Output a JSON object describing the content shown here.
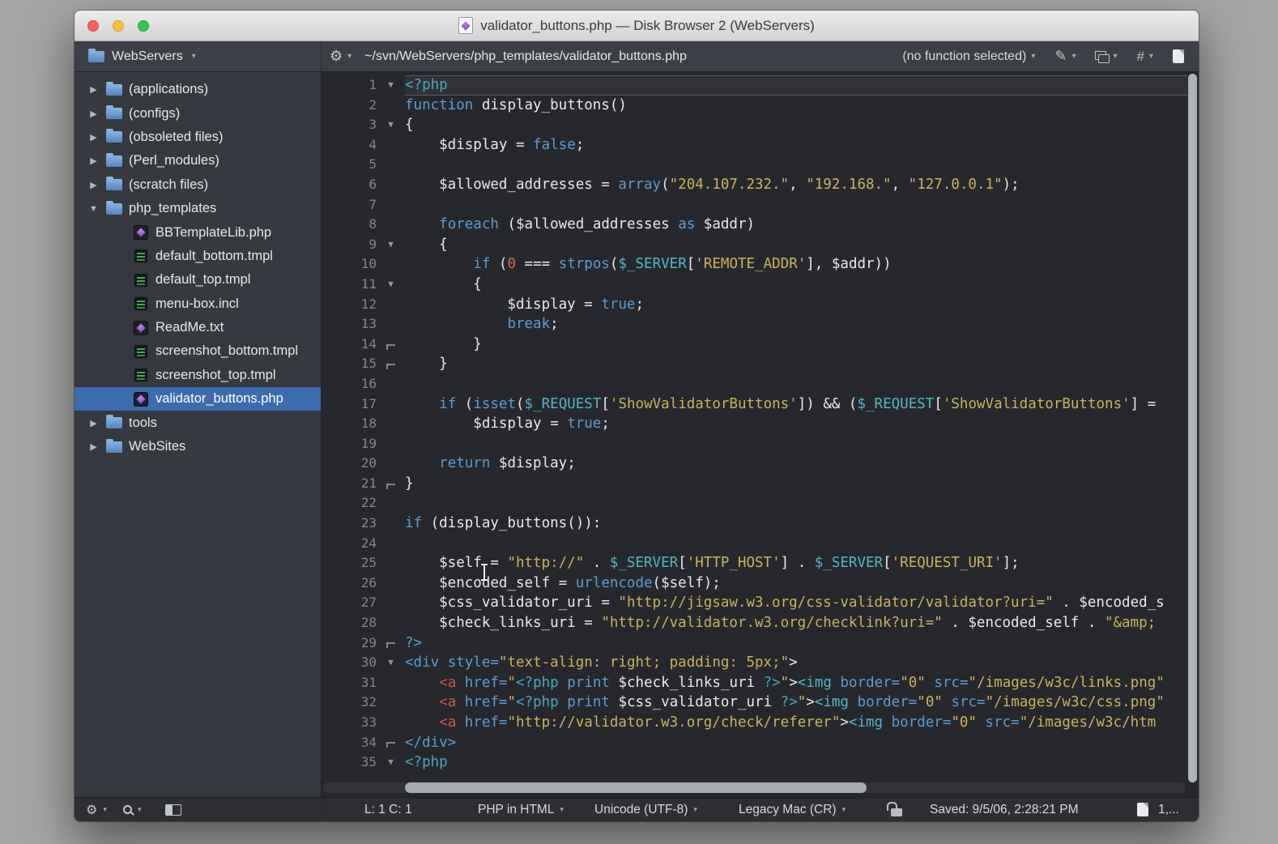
{
  "window": {
    "title": "validator_buttons.php — Disk Browser 2 (WebServers)"
  },
  "toolbar": {
    "sidebar_title": "WebServers",
    "path": "~/svn/WebServers/php_templates/validator_buttons.php",
    "function_selector": "(no function selected)"
  },
  "sidebar": {
    "items": [
      {
        "label": "(applications)",
        "kind": "folder",
        "arrow": "right",
        "depth": 0
      },
      {
        "label": "(configs)",
        "kind": "folder",
        "arrow": "right",
        "depth": 0
      },
      {
        "label": "(obsoleted files)",
        "kind": "folder",
        "arrow": "right",
        "depth": 0
      },
      {
        "label": "(Perl_modules)",
        "kind": "folder",
        "arrow": "right",
        "depth": 0
      },
      {
        "label": "(scratch files)",
        "kind": "folder",
        "arrow": "right",
        "depth": 0
      },
      {
        "label": "php_templates",
        "kind": "folder",
        "arrow": "down",
        "depth": 0
      },
      {
        "label": "BBTemplateLib.php",
        "kind": "doc",
        "depth": 1
      },
      {
        "label": "default_bottom.tmpl",
        "kind": "tmpl",
        "depth": 1
      },
      {
        "label": "default_top.tmpl",
        "kind": "tmpl",
        "depth": 1
      },
      {
        "label": "menu-box.incl",
        "kind": "tmpl",
        "depth": 1
      },
      {
        "label": "ReadMe.txt",
        "kind": "doc",
        "depth": 1
      },
      {
        "label": "screenshot_bottom.tmpl",
        "kind": "tmpl",
        "depth": 1
      },
      {
        "label": "screenshot_top.tmpl",
        "kind": "tmpl",
        "depth": 1
      },
      {
        "label": "validator_buttons.php",
        "kind": "doc",
        "depth": 1,
        "selected": true
      },
      {
        "label": "tools",
        "kind": "folder",
        "arrow": "right",
        "depth": 0
      },
      {
        "label": "WebSites",
        "kind": "folder",
        "arrow": "right",
        "depth": 0
      }
    ]
  },
  "editor": {
    "lines": [
      {
        "n": 1,
        "fold": "open",
        "cur": true,
        "segs": [
          [
            "<?php",
            "p"
          ]
        ]
      },
      {
        "n": 2,
        "segs": [
          [
            "function",
            "k"
          ],
          [
            " display_buttons()",
            "d"
          ]
        ]
      },
      {
        "n": 3,
        "fold": "open",
        "segs": [
          [
            "{",
            "d"
          ]
        ]
      },
      {
        "n": 4,
        "segs": [
          [
            "    $display = ",
            "d"
          ],
          [
            "false",
            "k"
          ],
          [
            ";",
            "d"
          ]
        ]
      },
      {
        "n": 5,
        "segs": []
      },
      {
        "n": 6,
        "segs": [
          [
            "    $allowed_addresses = ",
            "d"
          ],
          [
            "array",
            "k"
          ],
          [
            "(",
            "d"
          ],
          [
            "\"204.107.232.\"",
            "s"
          ],
          [
            ", ",
            "d"
          ],
          [
            "\"192.168.\"",
            "s"
          ],
          [
            ", ",
            "d"
          ],
          [
            "\"127.0.0.1\"",
            "s"
          ],
          [
            ");",
            "d"
          ]
        ]
      },
      {
        "n": 7,
        "segs": []
      },
      {
        "n": 8,
        "segs": [
          [
            "    ",
            "d"
          ],
          [
            "foreach",
            "k"
          ],
          [
            " ($allowed_addresses ",
            "d"
          ],
          [
            "as",
            "k"
          ],
          [
            " $addr)",
            "d"
          ]
        ]
      },
      {
        "n": 9,
        "fold": "open",
        "segs": [
          [
            "    {",
            "d"
          ]
        ]
      },
      {
        "n": 10,
        "segs": [
          [
            "        ",
            "d"
          ],
          [
            "if",
            "k"
          ],
          [
            " (",
            "d"
          ],
          [
            "0",
            "n"
          ],
          [
            " === ",
            "d"
          ],
          [
            "strpos",
            "k"
          ],
          [
            "(",
            "d"
          ],
          [
            "$_SERVER",
            "g"
          ],
          [
            "[",
            "d"
          ],
          [
            "'REMOTE_ADDR'",
            "s"
          ],
          [
            "], $addr))",
            "d"
          ]
        ]
      },
      {
        "n": 11,
        "fold": "open",
        "segs": [
          [
            "        {",
            "d"
          ]
        ]
      },
      {
        "n": 12,
        "segs": [
          [
            "            $display = ",
            "d"
          ],
          [
            "true",
            "k"
          ],
          [
            ";",
            "d"
          ]
        ]
      },
      {
        "n": 13,
        "segs": [
          [
            "            ",
            "d"
          ],
          [
            "break",
            "k"
          ],
          [
            ";",
            "d"
          ]
        ]
      },
      {
        "n": 14,
        "fold": "end",
        "segs": [
          [
            "        }",
            "d"
          ]
        ]
      },
      {
        "n": 15,
        "fold": "end",
        "segs": [
          [
            "    }",
            "d"
          ]
        ]
      },
      {
        "n": 16,
        "segs": []
      },
      {
        "n": 17,
        "segs": [
          [
            "    ",
            "d"
          ],
          [
            "if",
            "k"
          ],
          [
            " (",
            "d"
          ],
          [
            "isset",
            "k"
          ],
          [
            "(",
            "d"
          ],
          [
            "$_REQUEST",
            "g"
          ],
          [
            "[",
            "d"
          ],
          [
            "'ShowValidatorButtons'",
            "s"
          ],
          [
            "]) && (",
            "d"
          ],
          [
            "$_REQUEST",
            "g"
          ],
          [
            "[",
            "d"
          ],
          [
            "'ShowValidatorButtons'",
            "s"
          ],
          [
            "] =",
            "d"
          ]
        ]
      },
      {
        "n": 18,
        "segs": [
          [
            "        $display = ",
            "d"
          ],
          [
            "true",
            "k"
          ],
          [
            ";",
            "d"
          ]
        ]
      },
      {
        "n": 19,
        "segs": []
      },
      {
        "n": 20,
        "segs": [
          [
            "    ",
            "d"
          ],
          [
            "return",
            "k"
          ],
          [
            " $display;",
            "d"
          ]
        ]
      },
      {
        "n": 21,
        "fold": "end",
        "segs": [
          [
            "}",
            "d"
          ]
        ]
      },
      {
        "n": 22,
        "segs": []
      },
      {
        "n": 23,
        "segs": [
          [
            "if",
            "k"
          ],
          [
            " (display_buttons()):",
            "d"
          ]
        ]
      },
      {
        "n": 24,
        "segs": []
      },
      {
        "n": 25,
        "segs": [
          [
            "    $self = ",
            "d"
          ],
          [
            "\"http://\"",
            "s"
          ],
          [
            " . ",
            "d"
          ],
          [
            "$_SERVER",
            "g"
          ],
          [
            "[",
            "d"
          ],
          [
            "'HTTP_HOST'",
            "s"
          ],
          [
            "] . ",
            "d"
          ],
          [
            "$_SERVER",
            "g"
          ],
          [
            "[",
            "d"
          ],
          [
            "'REQUEST_URI'",
            "s"
          ],
          [
            "];",
            "d"
          ]
        ]
      },
      {
        "n": 26,
        "segs": [
          [
            "    $encoded_self = ",
            "d"
          ],
          [
            "urlencode",
            "k"
          ],
          [
            "($self);",
            "d"
          ]
        ]
      },
      {
        "n": 27,
        "segs": [
          [
            "    $css_validator_uri = ",
            "d"
          ],
          [
            "\"http://jigsaw.w3.org/css-validator/validator?uri=\"",
            "s"
          ],
          [
            " . $encoded_s",
            "d"
          ]
        ]
      },
      {
        "n": 28,
        "segs": [
          [
            "    $check_links_uri = ",
            "d"
          ],
          [
            "\"http://validator.w3.org/checklink?uri=\"",
            "s"
          ],
          [
            " . $encoded_self . ",
            "d"
          ],
          [
            "\"&amp;",
            "s"
          ]
        ]
      },
      {
        "n": 29,
        "fold": "end",
        "segs": [
          [
            "?>",
            "p"
          ]
        ]
      },
      {
        "n": 30,
        "fold": "open",
        "segs": [
          [
            "<div",
            "k"
          ],
          [
            " ",
            "d"
          ],
          [
            "style=",
            "k"
          ],
          [
            "\"text-align: right; padding: 5px;\"",
            "s"
          ],
          [
            ">",
            "d"
          ]
        ]
      },
      {
        "n": 31,
        "segs": [
          [
            "    ",
            "d"
          ],
          [
            "<a",
            "r"
          ],
          [
            " ",
            "d"
          ],
          [
            "href=",
            "k"
          ],
          [
            "\"",
            "s"
          ],
          [
            "<?php",
            "p"
          ],
          [
            " ",
            "d"
          ],
          [
            "print",
            "k"
          ],
          [
            " $check_links_uri ",
            "d"
          ],
          [
            "?>",
            "p"
          ],
          [
            "\"",
            "s"
          ],
          [
            ">",
            "d"
          ],
          [
            "<img",
            "c"
          ],
          [
            " ",
            "d"
          ],
          [
            "border=",
            "k"
          ],
          [
            "\"0\"",
            "s"
          ],
          [
            " ",
            "d"
          ],
          [
            "src=",
            "k"
          ],
          [
            "\"/images/w3c/links.png\"",
            "s"
          ]
        ]
      },
      {
        "n": 32,
        "segs": [
          [
            "    ",
            "d"
          ],
          [
            "<a",
            "r"
          ],
          [
            " ",
            "d"
          ],
          [
            "href=",
            "k"
          ],
          [
            "\"",
            "s"
          ],
          [
            "<?php",
            "p"
          ],
          [
            " ",
            "d"
          ],
          [
            "print",
            "k"
          ],
          [
            " $css_validator_uri ",
            "d"
          ],
          [
            "?>",
            "p"
          ],
          [
            "\"",
            "s"
          ],
          [
            ">",
            "d"
          ],
          [
            "<img",
            "c"
          ],
          [
            " ",
            "d"
          ],
          [
            "border=",
            "k"
          ],
          [
            "\"0\"",
            "s"
          ],
          [
            " ",
            "d"
          ],
          [
            "src=",
            "k"
          ],
          [
            "\"/images/w3c/css.png\"",
            "s"
          ]
        ]
      },
      {
        "n": 33,
        "segs": [
          [
            "    ",
            "d"
          ],
          [
            "<a",
            "r"
          ],
          [
            " ",
            "d"
          ],
          [
            "href=",
            "k"
          ],
          [
            "\"http://validator.w3.org/check/referer\"",
            "s"
          ],
          [
            ">",
            "d"
          ],
          [
            "<img",
            "c"
          ],
          [
            " ",
            "d"
          ],
          [
            "border=",
            "k"
          ],
          [
            "\"0\"",
            "s"
          ],
          [
            " ",
            "d"
          ],
          [
            "src=",
            "k"
          ],
          [
            "\"/images/w3c/htm",
            "s"
          ]
        ]
      },
      {
        "n": 34,
        "fold": "end",
        "segs": [
          [
            "</div>",
            "k"
          ]
        ]
      },
      {
        "n": 35,
        "fold": "open",
        "segs": [
          [
            "<?php",
            "p"
          ]
        ]
      }
    ]
  },
  "statusbar": {
    "cursor_position": "L: 1 C: 1",
    "language": "PHP in HTML",
    "encoding": "Unicode (UTF-8)",
    "line_ending": "Legacy Mac (CR)",
    "saved": "Saved: 9/5/06, 2:28:21 PM",
    "count": "1,..."
  },
  "colors": {
    "selection_blue": "#3a6cae",
    "toolbar_bg": "#3c3f45",
    "sidebar_bg": "#36393f",
    "editor_bg": "#26282d",
    "statusbar_bg": "#2d2f34",
    "tok_default": "#e8e9eb",
    "tok_keyword": "#5d9bd4",
    "tok_phptag": "#49a6c5",
    "tok_string": "#cbb25c",
    "tok_superglobal": "#52b5c9",
    "tok_number": "#d5684e",
    "tok_tag_red": "#d95149",
    "tok_tag_cyan": "#52b5c9",
    "traffic_red": "#fc605c",
    "traffic_yellow": "#fdbc40",
    "traffic_green": "#33c748"
  }
}
